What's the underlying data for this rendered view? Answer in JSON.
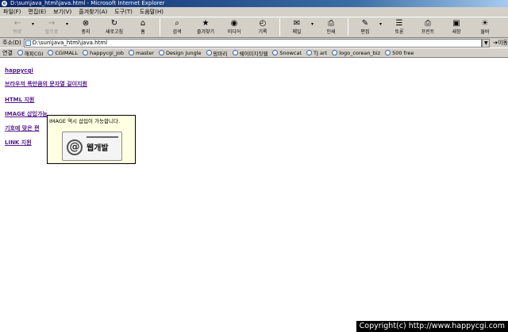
{
  "window": {
    "title": "D:\\sun\\java_html\\java.html - Microsoft Internet Explorer"
  },
  "menu": [
    "파일(F)",
    "편집(E)",
    "보기(V)",
    "즐겨찾기(A)",
    "도구(T)",
    "도움말(H)"
  ],
  "toolbar": {
    "back": "뒤로",
    "forward": "앞으로",
    "stop": "중지",
    "refresh": "새로고침",
    "home": "홈",
    "search": "검색",
    "favorites": "즐겨찾기",
    "media": "미디어",
    "history": "기록",
    "mail": "메일",
    "print": "인쇄",
    "edit": "편집",
    "discuss": "토론",
    "printer": "프린트",
    "messenger": "새창",
    "assistant": "둘바"
  },
  "address": {
    "label": "주소(D)",
    "value": "D:\\sun\\java_html\\java.html",
    "go": "이동"
  },
  "links": {
    "label": "연결",
    "items": [
      "해피CGI",
      "CGIMALL",
      "happycgi_job",
      "master",
      "Design Jungle",
      "맘마리",
      "쉐어미지짓웹",
      "Snowcat",
      "TJ art",
      "logo_corean_biz",
      "500 free"
    ]
  },
  "content": {
    "links": [
      "happycgi",
      "브라우저 폭만큼의 문자열 길이지원",
      "HTML 지원",
      "IMAGE 삽입가능",
      "기호에 맞은 편",
      "LINK 지원"
    ]
  },
  "tooltip": {
    "text": "IMAGE 역시 삽입이 가능합니다.",
    "logo_text": "웹개발"
  },
  "footer": {
    "copyright": "Copyright(c) http://www.happycgi.com"
  }
}
